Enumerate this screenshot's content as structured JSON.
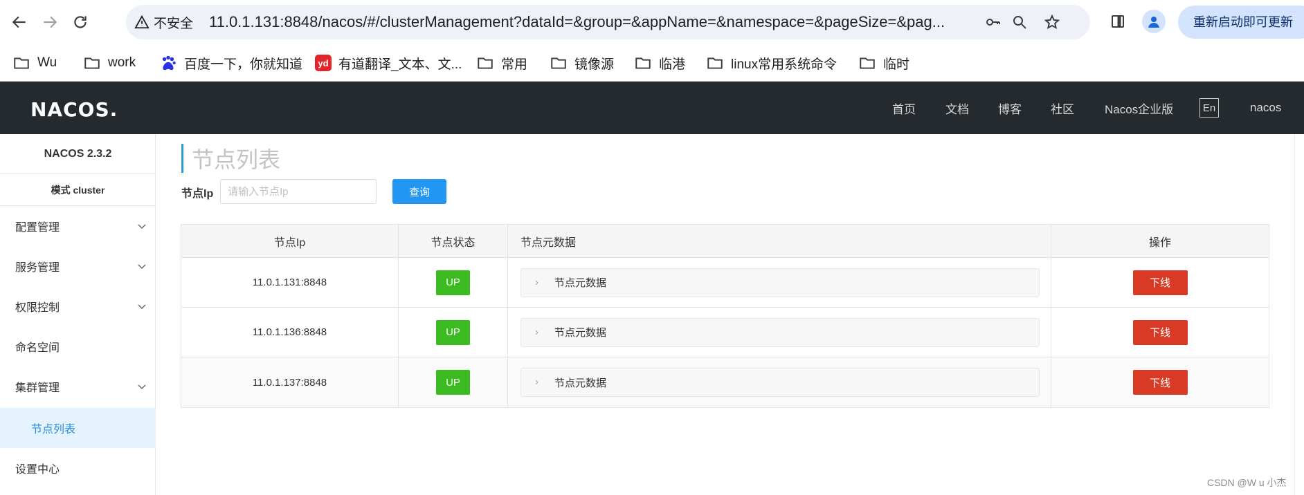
{
  "browser": {
    "security_label": "不安全",
    "url": "11.0.1.131:8848/nacos/#/clusterManagement?dataId=&group=&appName=&namespace=&pageSize=&pag...",
    "update_label": "重新启动即可更新"
  },
  "bookmarks": [
    {
      "label": "Wu",
      "icon": "folder-icon"
    },
    {
      "label": "work",
      "icon": "folder-icon"
    },
    {
      "label": "百度一下，你就知道",
      "icon": "baidu-icon"
    },
    {
      "label": "有道翻译_文本、文...",
      "icon": "youdao-icon",
      "badge": "yd"
    },
    {
      "label": "常用",
      "icon": "folder-icon"
    },
    {
      "label": "镜像源",
      "icon": "folder-icon"
    },
    {
      "label": "临港",
      "icon": "folder-icon"
    },
    {
      "label": "linux常用系统命令",
      "icon": "folder-icon"
    },
    {
      "label": "临时",
      "icon": "folder-icon"
    }
  ],
  "header": {
    "logo": "NACOS.",
    "nav": [
      "首页",
      "文档",
      "博客",
      "社区",
      "Nacos企业版"
    ],
    "lang": "En",
    "user": "nacos"
  },
  "sidebar": {
    "version": "NACOS 2.3.2",
    "mode": "模式 cluster",
    "items": [
      {
        "label": "配置管理",
        "expandable": true
      },
      {
        "label": "服务管理",
        "expandable": true
      },
      {
        "label": "权限控制",
        "expandable": true
      },
      {
        "label": "命名空间",
        "expandable": false
      },
      {
        "label": "集群管理",
        "expandable": true
      },
      {
        "label": "节点列表",
        "expandable": false,
        "active": true
      },
      {
        "label": "设置中心",
        "expandable": false
      }
    ]
  },
  "main": {
    "title": "节点列表",
    "filter_label": "节点Ip",
    "filter_placeholder": "请输入节点Ip",
    "filter_value": "",
    "query_label": "查询",
    "columns": [
      "节点Ip",
      "节点状态",
      "节点元数据",
      "操作"
    ],
    "rows": [
      {
        "ip": "11.0.1.131:8848",
        "state": "UP",
        "meta": "节点元数据",
        "action": "下线"
      },
      {
        "ip": "11.0.1.136:8848",
        "state": "UP",
        "meta": "节点元数据",
        "action": "下线"
      },
      {
        "ip": "11.0.1.137:8848",
        "state": "UP",
        "meta": "节点元数据",
        "action": "下线"
      }
    ]
  },
  "watermark": "CSDN @W u 小杰",
  "colors": {
    "header_bg": "#252a2f",
    "accent": "#2196f3",
    "status_up": "#3cba22",
    "danger": "#d93a26",
    "active_menu_bg": "#e4f3fe"
  }
}
